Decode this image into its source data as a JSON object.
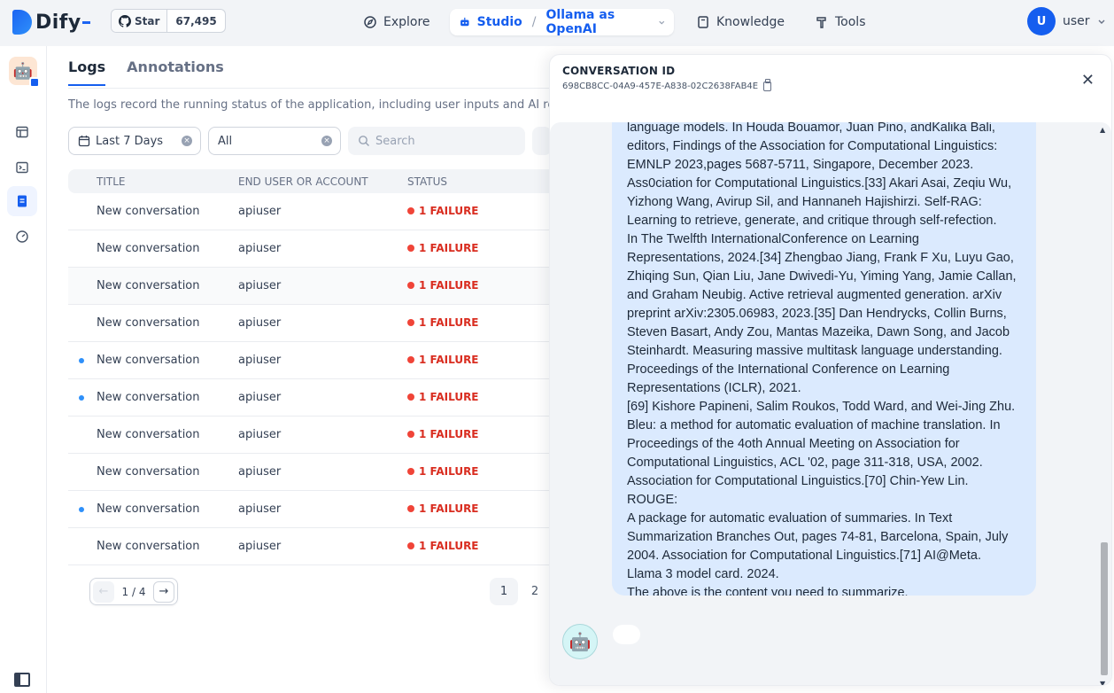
{
  "brand": {
    "name": "Dify"
  },
  "github": {
    "star_label": "Star",
    "star_count": "67,495"
  },
  "nav": {
    "explore": "Explore",
    "studio": "Studio",
    "app_name": "Ollama as OpenAI",
    "knowledge": "Knowledge",
    "tools": "Tools"
  },
  "user": {
    "initial": "U",
    "name": "user"
  },
  "logs": {
    "tabs": [
      "Logs",
      "Annotations"
    ],
    "description": "The logs record the running status of the application, including user inputs and AI replies",
    "filters": {
      "period": "Last 7 Days",
      "status": "All",
      "search_placeholder": "Search"
    },
    "columns": [
      "TITLE",
      "END USER OR ACCOUNT",
      "STATUS"
    ],
    "rows": [
      {
        "unread": false,
        "title": "New conversation",
        "user": "apiuser",
        "status": "1 FAILURE"
      },
      {
        "unread": false,
        "title": "New conversation",
        "user": "apiuser",
        "status": "1 FAILURE"
      },
      {
        "unread": false,
        "title": "New conversation",
        "user": "apiuser",
        "status": "1 FAILURE"
      },
      {
        "unread": false,
        "title": "New conversation",
        "user": "apiuser",
        "status": "1 FAILURE"
      },
      {
        "unread": true,
        "title": "New conversation",
        "user": "apiuser",
        "status": "1 FAILURE"
      },
      {
        "unread": true,
        "title": "New conversation",
        "user": "apiuser",
        "status": "1 FAILURE"
      },
      {
        "unread": false,
        "title": "New conversation",
        "user": "apiuser",
        "status": "1 FAILURE"
      },
      {
        "unread": false,
        "title": "New conversation",
        "user": "apiuser",
        "status": "1 FAILURE"
      },
      {
        "unread": true,
        "title": "New conversation",
        "user": "apiuser",
        "status": "1 FAILURE"
      },
      {
        "unread": false,
        "title": "New conversation",
        "user": "apiuser",
        "status": "1 FAILURE"
      }
    ],
    "pagination": {
      "current": "1",
      "total": "4",
      "pages": [
        "1",
        "2"
      ]
    }
  },
  "drawer": {
    "label": "CONVERSATION ID",
    "conversation_id": "698CB8CC-04A9-457E-A838-02C2638FAB4E",
    "message": "language models. In Houda Bouamor, Juan Pino, andKalika Bali,\neditors, Findings of the Association for Computational Linguistics:\nEMNLP 2023,pages 5687-5711, Singapore, December 2023.\nAss0ciation for Computational Linguistics.[33] Akari Asai, Zeqiu Wu,\nYizhong Wang, Avirup Sil, and Hannaneh Hajishirzi. Self-RAG:\nLearning to retrieve, generate, and critique through self-refection.\nIn The Twelfth InternationalConference on Learning\nRepresentations, 2024.[34] Zhengbao Jiang, Frank F Xu, Luyu Gao,\nZhiqing Sun, Qian Liu, Jane Dwivedi-Yu, Yiming Yang, Jamie Callan,\nand Graham Neubig. Active retrieval augmented generation. arXiv\npreprint arXiv:2305.06983, 2023.[35] Dan Hendrycks, Collin Burns,\nSteven Basart, Andy Zou, Mantas Mazeika, Dawn Song, and Jacob\nSteinhardt. Measuring massive multitask language understanding.\nProceedings of the International Conference on Learning\nRepresentations (ICLR), 2021.\n[69] Kishore Papineni, Salim Roukos, Todd Ward, and Wei-Jing Zhu.\nBleu: a method for automatic evaluation of machine translation. In\nProceedings of the 4oth Annual Meeting on Association for\nComputational Linguistics, ACL '02, page 311-318, USA, 2002.\nAssociation for Computational Linguistics.[70] Chin-Yew Lin. ROUGE:\nA package for automatic evaluation of summaries. In Text\nSummarization Branches Out, pages 74-81, Barcelona, Spain, July\n2004. Association for Computational Linguistics.[71] AI@Meta.\nLlama 3 model card. 2024.\nThe above is the content you need to summarize."
  },
  "colors": {
    "accent": "#155eef",
    "failure": "#d92d20",
    "bubble": "#dbeafe"
  }
}
